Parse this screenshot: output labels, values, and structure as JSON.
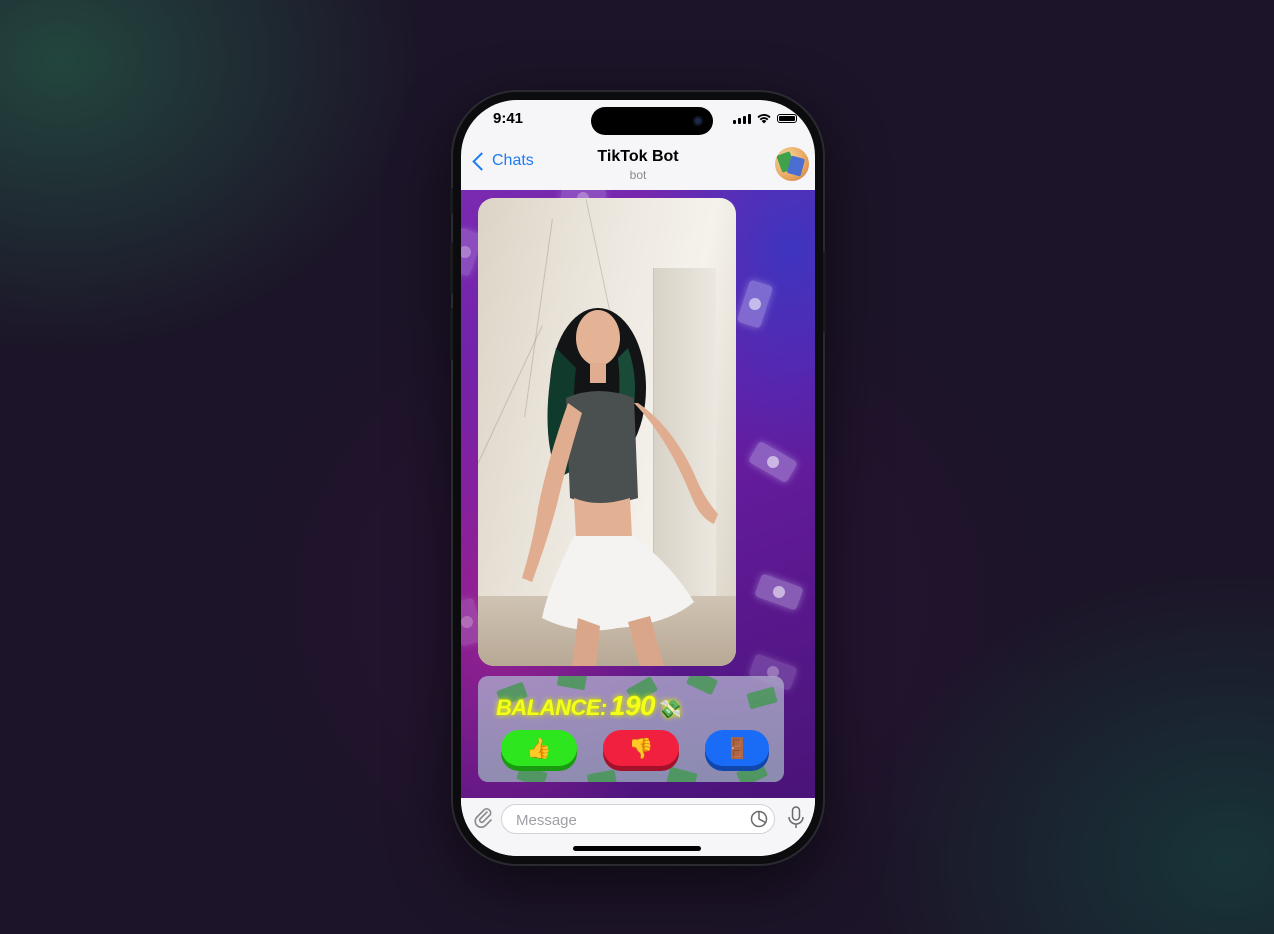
{
  "status_bar": {
    "time": "9:41",
    "icons": [
      "cellular-signal-icon",
      "wifi-icon",
      "battery-icon"
    ]
  },
  "navbar": {
    "back_label": "Chats",
    "title": "TikTok Bot",
    "subtitle": "bot",
    "avatar_icon": "bot-avatar-money-icon"
  },
  "video_message": {
    "content": "video-of-dancing-woman"
  },
  "game_panel": {
    "balance_label": "BALANCE:",
    "balance_value": "190",
    "balance_icon": "💸",
    "buttons": [
      {
        "icon": "👍",
        "name": "like",
        "color": "#2ee61d"
      },
      {
        "icon": "👎",
        "name": "dislike",
        "color": "#f0203e"
      },
      {
        "icon": "🚪",
        "name": "exit",
        "color": "#1a6cf6"
      }
    ]
  },
  "composer": {
    "placeholder": "Message",
    "value": "",
    "icons": [
      "paperclip-icon",
      "sticker-icon",
      "microphone-icon"
    ]
  },
  "colors": {
    "accent": "#1e7cf2",
    "chat_background": "#6a1ea6",
    "balance_text": "#f4ff1a"
  }
}
